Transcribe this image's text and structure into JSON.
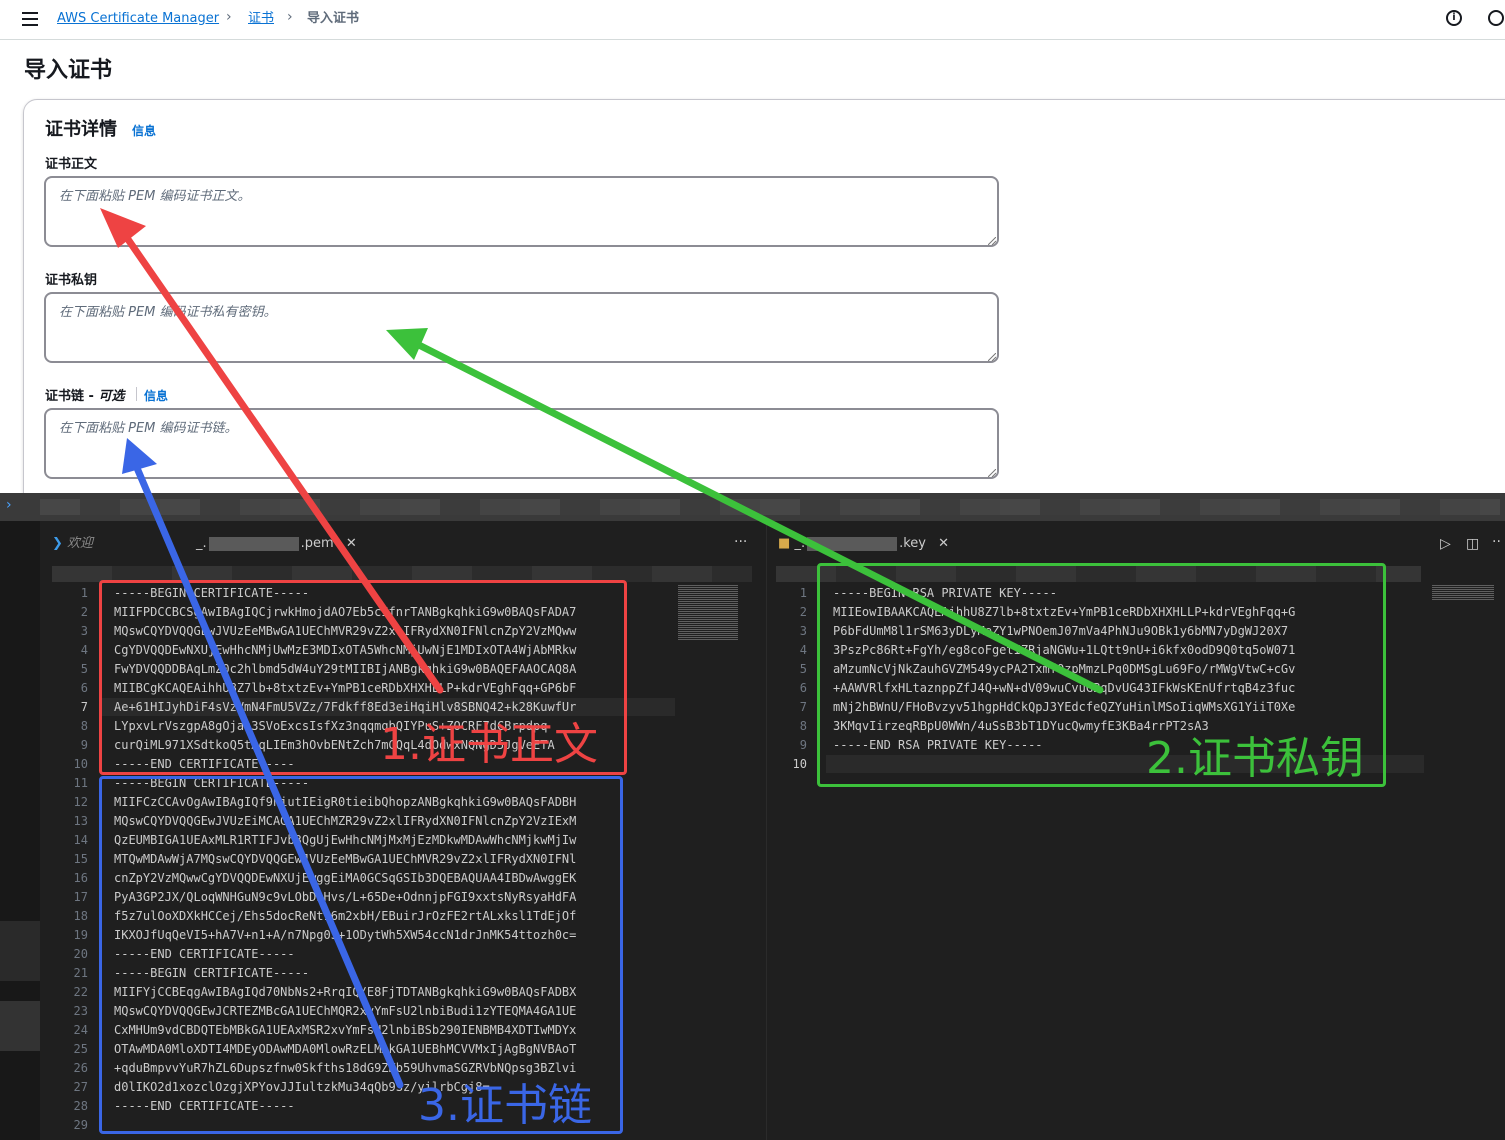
{
  "breadcrumb": {
    "service": "AWS Certificate Manager",
    "certs": "证书",
    "current": "导入证书"
  },
  "page": {
    "title": "导入证书"
  },
  "panel": {
    "title": "证书详情",
    "info": "信息",
    "body_label": "证书正文",
    "body_placeholder": "在下面粘贴 PEM 编码证书正文。",
    "key_label": "证书私钥",
    "key_placeholder": "在下面粘贴 PEM 编码证书私有密钥。",
    "chain_label": "证书链 - ",
    "chain_optional": "可选",
    "chain_info": "信息",
    "chain_placeholder": "在下面粘贴 PEM 编码证书链。"
  },
  "editor": {
    "left": {
      "tab_welcome": "欢迎",
      "tab_file_prefix": "_.",
      "tab_file_suffix": ".pem",
      "lines": [
        "-----BEGIN CERTIFICATE-----",
        "MIIFPDCCBCSgAwIBAgIQCjrwkHmojdAO7Eb5cIfnrTANBgkqhkiG9w0BAQsFADA7",
        "MQswCQYDVQQGEwJVUzEeMBwGA1UEChMVR29vZ2xlIFRydXN0IFNlcnZpY2VzMQww",
        "CgYDVQQDEwNXUjEwHhcNMjUwMzE3MDIxOTA5WhcNMjUwNjE1MDIxOTA4WjAbMRkw",
        "FwYDVQQDDBAqLmZ0c2hlbmd5dW4uY29tMIIBIjANBgkqhkiG9w0BAQEFAAOCAQ8A",
        "MIIBCgKCAQEAihhU8Z7lb+8txtzEv+YmPB1ceRDbXHXHLLP+kdrVEghFqq+GP6bF",
        "Ae+61HIJyhDiF4sVzVmN4FmU5VZz/7Fdkff8Ed3eiHqiHlv8SBNQ42+k28KuwfUr",
        "LYpxvLrVszgpA8gOjas3SVoExcsIsfXz3nqqmqbQIYPuS+ZOCRF7dCBrpdpq",
        "curQiML971XSdtkoQ5tAqLIEm3hOvbENtZch7mGQqL4dOdwxNQNgD5JgVeETA",
        "-----END CERTIFICATE-----",
        "-----BEGIN CERTIFICATE-----",
        "MIIFCzCCAvOgAwIBAgIQf9niutIEigR0tieibQhopzANBgkqhkiG9w0BAQsFADBH",
        "MQswCQYDVQQGEwJVUzEiMCAGA1UEChMZR29vZ2xlIFRydXN0IFNlcnZpY2VzIExM",
        "QzEUMBIGA1UEAxMLR1RTIFJvb3QgUjEwHhcNMjMxMjEzMDkwMDAwWhcNMjkwMjIw",
        "MTQwMDAwWjA7MQswCQYDVQQGEwJVUzEeMBwGA1UEChMVR29vZ2xlIFRydXN0IFNl",
        "cnZpY2VzMQwwCgYDVQQDEwNXUjEwggEiMA0GCSqGSIb3DQEBAQUAA4IBDwAwggEK",
        "PyA3GP2JX/QLoqWNHGuN9c9vLObDhHvs/L+65De+OdnnjpFGI9xxtsNyRsyaHdFA",
        "f5z7ulOoXDXkHCCej/Ehs5docReNt16m2xbH/EBuirJrOzFE2rtALxksl1TdEjOf",
        "IKXOJfUqQeVI5+hA7V+n1+A/n7Npg0S+1ODytWh5XW54ccN1drJnMK54ttozh0c=",
        "-----END CERTIFICATE-----",
        "-----BEGIN CERTIFICATE-----",
        "MIIFYjCCBEqgAwIBAgIQd70NbNs2+RrqIQ/E8FjTDTANBgkqhkiG9w0BAQsFADBX",
        "MQswCQYDVQQGEwJCRTEZMBcGA1UEChMQR2xvYmFsU2lnbiBudi1zYTEQMA4GA1UE",
        "CxMHUm9vdCBDQTEbMBkGA1UEAxMSR2xvYmFsU2lnbiBSb290IENBMB4XDTIwMDYx",
        "OTAwMDA0MloXDTI4MDEyODAwMDA0MlowRzELMAkGA1UEBhMCVVMxIjAgBgNVBAoT",
        "+qduBmpvvYuR7hZL6Dupszfnw0Skfths18dG9ZKb59UhvmaSGZRVbNQpsg3BZlvi",
        "d0lIKO2d1xozclOzgjXPYovJJIultzkMu34qQb9Sz/yilrbCgj8=",
        "-----END CERTIFICATE-----",
        ""
      ],
      "line_numbers": [
        "1",
        "2",
        "3",
        "4",
        "5",
        "6",
        "7",
        "8",
        "9",
        "10",
        "11",
        "12",
        "13",
        "14",
        "15",
        "16",
        "17",
        "18",
        "19",
        "20",
        "21",
        "22",
        "23",
        "24",
        "25",
        "26",
        "27",
        "28",
        "29"
      ]
    },
    "right": {
      "tab_file_prefix": "_.",
      "tab_file_suffix": ".key",
      "lines": [
        "-----BEGIN RSA PRIVATE KEY-----",
        "MIIEowIBAAKCAQEAihhU8Z7lb+8txtzEv+YmPB1ceRDbXHXHLLP+kdrVEghFqq+G",
        "P6bFdUmM8l1rSM63yDLyMeZY1wPNOemJ07mVa4PhNJu9OBk1y6bMN7yDgWJ20X7",
        "3PszPc86Rt+FgYh/eg8coFgetIZRjaNGWu+1LQtt9nU+i6kfx0odD9Q0tq5oW071",
        "aMzumNcVjNkZauhGVZM549ycPA2TxmfOzpMmzLPq0DMSgLu69Fo/rMWgVtwC+cGv",
        "+AAWVRlfxHLtaznppZfJ4Q+wN+dV09wuCvuGBqDvUG43IFkWsKEnUfrtqB4z3fuc",
        "mNj2hBWnU/FHoBvzyv51hgpHdCkQpJ3YEdcfeQZYuHinlMSoIiqWMsXG1YiiT0Xe",
        "3KMqvIirzeqRBpU0WWn/4uSsB3bT1DYucQwmyfE3KBa4rrPT2sA3",
        "-----END RSA PRIVATE KEY-----",
        ""
      ],
      "line_numbers": [
        "1",
        "2",
        "3",
        "4",
        "5",
        "6",
        "7",
        "8",
        "9",
        "10"
      ]
    }
  },
  "annotations": {
    "body": "1.证书正文",
    "key": "2.证书私钥",
    "chain": "3.证书链"
  },
  "colors": {
    "red": "#ee4343",
    "green": "#3cc13b",
    "blue": "#3a66e6",
    "link": "#0972d3"
  }
}
